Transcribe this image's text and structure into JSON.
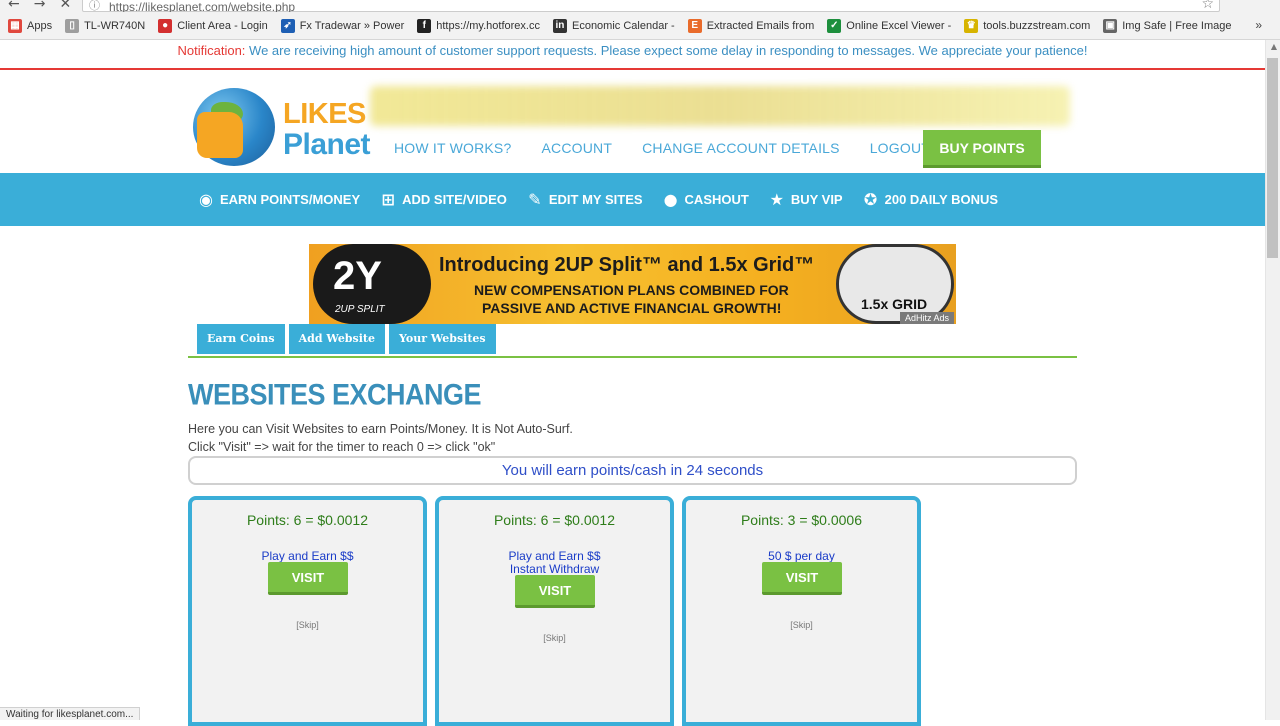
{
  "browser": {
    "url": "https://likesplanet.com/website.php",
    "bookmarks": [
      {
        "label": "Apps",
        "color": "#e0483e",
        "glyph": "▦"
      },
      {
        "label": "TL-WR740N",
        "color": "#9e9e9e",
        "glyph": "▯"
      },
      {
        "label": "Client Area - Login",
        "color": "#d32f2f",
        "glyph": "●"
      },
      {
        "label": "Fx Tradewar » Power",
        "color": "#1e5fb4",
        "glyph": "➶"
      },
      {
        "label": "https://my.hotforex.cc",
        "color": "#222222",
        "glyph": "f"
      },
      {
        "label": "Economic Calendar -",
        "color": "#333333",
        "glyph": "in"
      },
      {
        "label": "Extracted Emails from",
        "color": "#e96b2b",
        "glyph": "E"
      },
      {
        "label": "Online Excel Viewer -",
        "color": "#1d8f3d",
        "glyph": "✓"
      },
      {
        "label": "tools.buzzstream.com",
        "color": "#d7b400",
        "glyph": "♛"
      },
      {
        "label": "Img Safe | Free Image",
        "color": "#666666",
        "glyph": "▣"
      }
    ],
    "status_text": "Waiting for likesplanet.com..."
  },
  "notification": {
    "label": "Notification:",
    "message": "We are receiving high amount of customer support requests. Please expect some delay in responding to messages. We appreciate your patience!"
  },
  "header": {
    "logo_likes": "LIKES",
    "logo_planet": "Planet",
    "menu": [
      "HOW IT WORKS?",
      "ACCOUNT",
      "CHANGE ACCOUNT DETAILS",
      "LOGOUT"
    ],
    "buy_points": "BUY POINTS"
  },
  "blue_nav": [
    {
      "label": "EARN POINTS/MONEY",
      "icon": "coins-icon",
      "glyph": "◉"
    },
    {
      "label": "ADD SITE/VIDEO",
      "icon": "add-icon",
      "glyph": "⊞"
    },
    {
      "label": "EDIT MY SITES",
      "icon": "edit-icon",
      "glyph": "✎"
    },
    {
      "label": "CASHOUT",
      "icon": "piggy-bank-icon",
      "glyph": "●"
    },
    {
      "label": "BUY VIP",
      "icon": "star-icon",
      "glyph": "★"
    },
    {
      "label": "200 DAILY BONUS",
      "icon": "medal-icon",
      "glyph": "✪"
    }
  ],
  "banner": {
    "logo_left": "2Y",
    "logo_left_sub": "2UP SPLIT",
    "headline": "Introducing 2UP Split™ and 1.5x Grid™",
    "line2": "NEW COMPENSATION PLANS COMBINED FOR",
    "line3": "PASSIVE AND ACTIVE FINANCIAL GROWTH!",
    "logo_right": "1.5x GRID",
    "ad_label": "AdHitz Ads"
  },
  "tabs": [
    "Earn Coins",
    "Add Website",
    "Your Websites"
  ],
  "page": {
    "title": "WEBSITES EXCHANGE",
    "desc1": "Here you can Visit Websites to earn Points/Money. It is Not Auto-Surf.",
    "desc2": "Click \"Visit\" => wait for the timer to reach 0 => click \"ok\"",
    "timer": "You will earn points/cash in 24 seconds"
  },
  "cards": [
    {
      "points": "Points: 6 = $0.0012",
      "title_lines": [
        "Play and Earn $$"
      ],
      "visit": "VISIT",
      "skip": "[Skip]"
    },
    {
      "points": "Points: 6 = $0.0012",
      "title_lines": [
        "Play and Earn $$",
        "Instant Withdraw"
      ],
      "visit": "VISIT",
      "skip": "[Skip]"
    },
    {
      "points": "Points: 3 = $0.0006",
      "title_lines": [
        "50 $ per day"
      ],
      "visit": "VISIT",
      "skip": "[Skip]"
    }
  ]
}
